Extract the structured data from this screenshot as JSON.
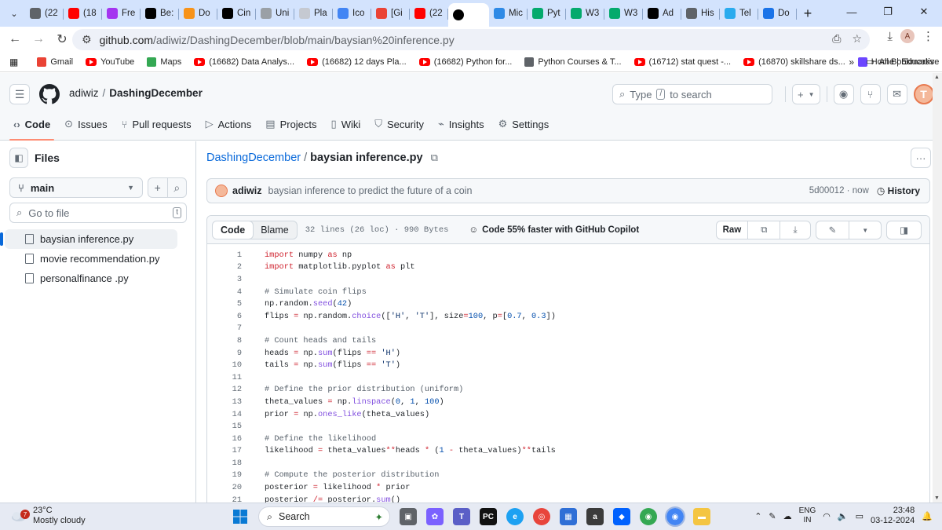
{
  "browser": {
    "tabs": [
      {
        "label": "(22",
        "icon": "generic-icon",
        "color": "#5f6368"
      },
      {
        "label": "(18",
        "icon": "youtube-icon",
        "color": "#ff0000"
      },
      {
        "label": "Fre",
        "icon": "udemy-icon",
        "color": "#a435f0"
      },
      {
        "label": "Be:",
        "icon": "imdb-icon",
        "color": "#000000"
      },
      {
        "label": "Do",
        "icon": "bitcoin-icon",
        "color": "#f7931a"
      },
      {
        "label": "Cin",
        "icon": "imdb-icon",
        "color": "#000000"
      },
      {
        "label": "Uni",
        "icon": "chart-icon",
        "color": "#9aa0a6"
      },
      {
        "label": "Pla",
        "icon": "play-icon",
        "color": "#c5c9d1"
      },
      {
        "label": "Ico",
        "icon": "forms-icon",
        "color": "#4285f4"
      },
      {
        "label": "[Gi",
        "icon": "gmail-icon",
        "color": "#ea4335"
      },
      {
        "label": "(22",
        "icon": "youtube-icon",
        "color": "#ff0000"
      },
      {
        "label": "",
        "icon": "github-icon",
        "color": "#000000",
        "active": true
      },
      {
        "label": "Mic",
        "icon": "copilot-icon",
        "color": "#2e8ae6"
      },
      {
        "label": "Pyt",
        "icon": "w3schools-icon",
        "color": "#04aa6d"
      },
      {
        "label": "W3",
        "icon": "w3schools-icon",
        "color": "#04aa6d"
      },
      {
        "label": "W3",
        "icon": "w3schools-icon",
        "color": "#04aa6d"
      },
      {
        "label": "Ad",
        "icon": "x-icon",
        "color": "#000000"
      },
      {
        "label": "His",
        "icon": "history-icon",
        "color": "#5f6368"
      },
      {
        "label": "Tel",
        "icon": "telegram-icon",
        "color": "#2aabee"
      },
      {
        "label": "Do",
        "icon": "download-icon",
        "color": "#1a73e8"
      }
    ],
    "url_domain": "github.com",
    "url_path": "/adiwiz/DashingDecember/blob/main/baysian%20inference.py",
    "profile_initial": "A",
    "bookmarks": [
      {
        "label": "Gmail",
        "icon": "gmail-icon"
      },
      {
        "label": "YouTube",
        "icon": "youtube-icon"
      },
      {
        "label": "Maps",
        "icon": "maps-icon"
      },
      {
        "label": "(16682) Data Analys...",
        "icon": "youtube-icon"
      },
      {
        "label": "(16682) 12 days Pla...",
        "icon": "youtube-icon"
      },
      {
        "label": "(16682) Python for...",
        "icon": "youtube-icon"
      },
      {
        "label": "Python Courses & T...",
        "icon": "doc-icon"
      },
      {
        "label": "(16712) stat quest -...",
        "icon": "youtube-icon"
      },
      {
        "label": "(16870) skillshare ds...",
        "icon": "youtube-icon"
      },
      {
        "label": "Home | Educative",
        "icon": "educative-icon"
      }
    ],
    "all_bookmarks": "All Bookmarks"
  },
  "github": {
    "owner": "adiwiz",
    "repo": "DashingDecember",
    "search_placeholder_pre": "Type",
    "search_key": "/",
    "search_placeholder_post": "to search",
    "nav": [
      {
        "label": "Code",
        "icon": "code-icon",
        "selected": true
      },
      {
        "label": "Issues",
        "icon": "issue-icon"
      },
      {
        "label": "Pull requests",
        "icon": "pull-request-icon"
      },
      {
        "label": "Actions",
        "icon": "play-icon"
      },
      {
        "label": "Projects",
        "icon": "table-icon"
      },
      {
        "label": "Wiki",
        "icon": "book-icon"
      },
      {
        "label": "Security",
        "icon": "shield-icon"
      },
      {
        "label": "Insights",
        "icon": "graph-icon"
      },
      {
        "label": "Settings",
        "icon": "gear-icon"
      }
    ]
  },
  "sidebar": {
    "title": "Files",
    "branch": "main",
    "goto_placeholder": "Go to file",
    "goto_key": "t",
    "files": [
      {
        "name": "baysian inference.py",
        "selected": true
      },
      {
        "name": "movie recommendation.py"
      },
      {
        "name": "personalfinance .py"
      }
    ]
  },
  "file": {
    "repo_link": "DashingDecember",
    "name": "baysian inference.py",
    "commit_author": "adiwiz",
    "commit_message": "baysian inference to predict the future of a coin",
    "commit_sha": "5d00012",
    "commit_time": "now",
    "history_label": "History",
    "tab_code": "Code",
    "tab_blame": "Blame",
    "meta": "32 lines (26 loc) · 990 Bytes",
    "copilot": "Code 55% faster with GitHub Copilot",
    "raw_label": "Raw",
    "lines": [
      {
        "n": "1",
        "html": "<span class=\"kw\">import</span> numpy <span class=\"kw\">as</span> np"
      },
      {
        "n": "2",
        "html": "<span class=\"kw\">import</span> matplotlib.pyplot <span class=\"kw\">as</span> plt"
      },
      {
        "n": "3",
        "html": ""
      },
      {
        "n": "4",
        "html": "<span class=\"cm\"># Simulate coin flips</span>"
      },
      {
        "n": "5",
        "html": "np.random.<span class=\"fn\">seed</span>(<span class=\"nm\">42</span>)"
      },
      {
        "n": "6",
        "html": "flips <span class=\"kw\">=</span> np.random.<span class=\"fn\">choice</span>([<span class=\"st\">'H'</span>, <span class=\"st\">'T'</span>], size<span class=\"kw\">=</span><span class=\"nm\">100</span>, p<span class=\"kw\">=</span>[<span class=\"nm\">0.7</span>, <span class=\"nm\">0.3</span>])"
      },
      {
        "n": "7",
        "html": ""
      },
      {
        "n": "8",
        "html": "<span class=\"cm\"># Count heads and tails</span>"
      },
      {
        "n": "9",
        "html": "heads <span class=\"kw\">=</span> np.<span class=\"fn\">sum</span>(flips <span class=\"kw\">==</span> <span class=\"st\">'H'</span>)"
      },
      {
        "n": "10",
        "html": "tails <span class=\"kw\">=</span> np.<span class=\"fn\">sum</span>(flips <span class=\"kw\">==</span> <span class=\"st\">'T'</span>)"
      },
      {
        "n": "11",
        "html": ""
      },
      {
        "n": "12",
        "html": "<span class=\"cm\"># Define the prior distribution (uniform)</span>"
      },
      {
        "n": "13",
        "html": "theta_values <span class=\"kw\">=</span> np.<span class=\"fn\">linspace</span>(<span class=\"nm\">0</span>, <span class=\"nm\">1</span>, <span class=\"nm\">100</span>)"
      },
      {
        "n": "14",
        "html": "prior <span class=\"kw\">=</span> np.<span class=\"fn\">ones_like</span>(theta_values)"
      },
      {
        "n": "15",
        "html": ""
      },
      {
        "n": "16",
        "html": "<span class=\"cm\"># Define the likelihood</span>"
      },
      {
        "n": "17",
        "html": "likelihood <span class=\"kw\">=</span> theta_values<span class=\"kw\">**</span>heads <span class=\"kw\">*</span> (<span class=\"nm\">1</span> <span class=\"kw\">-</span> theta_values)<span class=\"kw\">**</span>tails"
      },
      {
        "n": "18",
        "html": ""
      },
      {
        "n": "19",
        "html": "<span class=\"cm\"># Compute the posterior distribution</span>"
      },
      {
        "n": "20",
        "html": "posterior <span class=\"kw\">=</span> likelihood <span class=\"kw\">*</span> prior"
      },
      {
        "n": "21",
        "html": "posterior <span class=\"kw\">/=</span> posterior.<span class=\"fn\">sum</span>()"
      }
    ]
  },
  "taskbar": {
    "weather_temp": "23°C",
    "weather_desc": "Mostly cloudy",
    "weather_badge": "7",
    "search_label": "Search",
    "lang_top": "ENG",
    "lang_bottom": "IN",
    "time": "23:48",
    "date": "03-12-2024"
  }
}
